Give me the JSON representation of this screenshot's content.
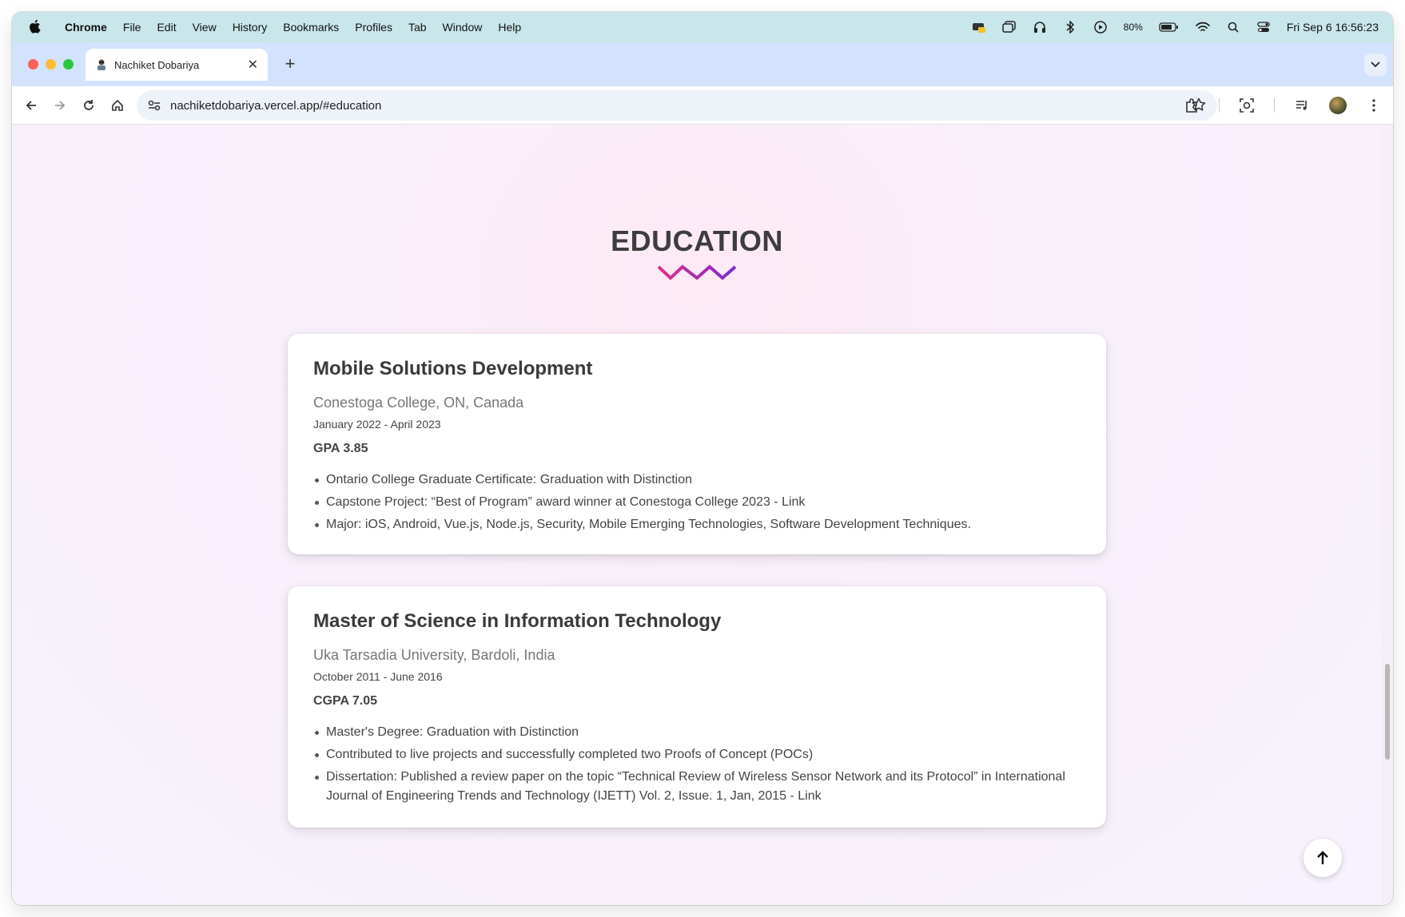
{
  "menubar": {
    "items": [
      "Chrome",
      "File",
      "Edit",
      "View",
      "History",
      "Bookmarks",
      "Profiles",
      "Tab",
      "Window",
      "Help"
    ],
    "battery": "80%",
    "clock": "Fri Sep 6  16:56:23"
  },
  "browser": {
    "tab_title": "Nachiket Dobariya",
    "url": "nachiketdobariya.vercel.app/#education"
  },
  "page": {
    "section_title": "EDUCATION",
    "accent_gradient": [
      "#e0308a",
      "#7a2bd6"
    ],
    "education": [
      {
        "degree": "Mobile Solutions Development",
        "school": "Conestoga College, ON, Canada",
        "dates": "January 2022 - April 2023",
        "grade": "GPA 3.85",
        "points": [
          "Ontario College Graduate Certificate: Graduation with Distinction",
          "Capstone Project: “Best of Program” award winner at Conestoga College 2023 - Link",
          "Major: iOS, Android, Vue.js, Node.js, Security, Mobile Emerging Technologies, Software Development Techniques."
        ]
      },
      {
        "degree": "Master of Science in Information Technology",
        "school": "Uka Tarsadia University, Bardoli, India",
        "dates": "October 2011 - June 2016",
        "grade": "CGPA 7.05",
        "points": [
          "Master's Degree: Graduation with Distinction",
          "Contributed to live projects and successfully completed two Proofs of Concept (POCs)",
          "Dissertation: Published a review paper on the topic “Technical Review of Wireless Sensor Network and its Protocol” in International Journal of Engineering Trends and Technology (IJETT) Vol. 2, Issue. 1, Jan, 2015 - Link"
        ]
      }
    ]
  }
}
